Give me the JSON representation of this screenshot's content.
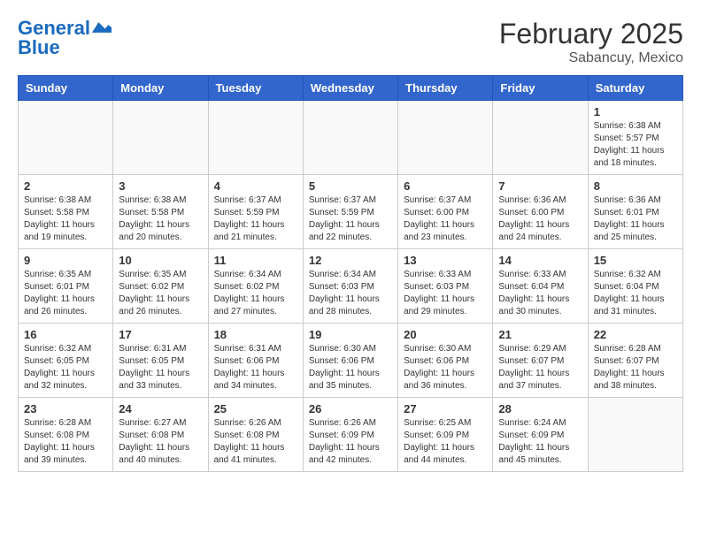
{
  "header": {
    "logo_line1": "General",
    "logo_line2": "Blue",
    "month_year": "February 2025",
    "location": "Sabancuy, Mexico"
  },
  "weekdays": [
    "Sunday",
    "Monday",
    "Tuesday",
    "Wednesday",
    "Thursday",
    "Friday",
    "Saturday"
  ],
  "weeks": [
    [
      {
        "day": "",
        "info": ""
      },
      {
        "day": "",
        "info": ""
      },
      {
        "day": "",
        "info": ""
      },
      {
        "day": "",
        "info": ""
      },
      {
        "day": "",
        "info": ""
      },
      {
        "day": "",
        "info": ""
      },
      {
        "day": "1",
        "info": "Sunrise: 6:38 AM\nSunset: 5:57 PM\nDaylight: 11 hours and 18 minutes."
      }
    ],
    [
      {
        "day": "2",
        "info": "Sunrise: 6:38 AM\nSunset: 5:58 PM\nDaylight: 11 hours and 19 minutes."
      },
      {
        "day": "3",
        "info": "Sunrise: 6:38 AM\nSunset: 5:58 PM\nDaylight: 11 hours and 20 minutes."
      },
      {
        "day": "4",
        "info": "Sunrise: 6:37 AM\nSunset: 5:59 PM\nDaylight: 11 hours and 21 minutes."
      },
      {
        "day": "5",
        "info": "Sunrise: 6:37 AM\nSunset: 5:59 PM\nDaylight: 11 hours and 22 minutes."
      },
      {
        "day": "6",
        "info": "Sunrise: 6:37 AM\nSunset: 6:00 PM\nDaylight: 11 hours and 23 minutes."
      },
      {
        "day": "7",
        "info": "Sunrise: 6:36 AM\nSunset: 6:00 PM\nDaylight: 11 hours and 24 minutes."
      },
      {
        "day": "8",
        "info": "Sunrise: 6:36 AM\nSunset: 6:01 PM\nDaylight: 11 hours and 25 minutes."
      }
    ],
    [
      {
        "day": "9",
        "info": "Sunrise: 6:35 AM\nSunset: 6:01 PM\nDaylight: 11 hours and 26 minutes."
      },
      {
        "day": "10",
        "info": "Sunrise: 6:35 AM\nSunset: 6:02 PM\nDaylight: 11 hours and 26 minutes."
      },
      {
        "day": "11",
        "info": "Sunrise: 6:34 AM\nSunset: 6:02 PM\nDaylight: 11 hours and 27 minutes."
      },
      {
        "day": "12",
        "info": "Sunrise: 6:34 AM\nSunset: 6:03 PM\nDaylight: 11 hours and 28 minutes."
      },
      {
        "day": "13",
        "info": "Sunrise: 6:33 AM\nSunset: 6:03 PM\nDaylight: 11 hours and 29 minutes."
      },
      {
        "day": "14",
        "info": "Sunrise: 6:33 AM\nSunset: 6:04 PM\nDaylight: 11 hours and 30 minutes."
      },
      {
        "day": "15",
        "info": "Sunrise: 6:32 AM\nSunset: 6:04 PM\nDaylight: 11 hours and 31 minutes."
      }
    ],
    [
      {
        "day": "16",
        "info": "Sunrise: 6:32 AM\nSunset: 6:05 PM\nDaylight: 11 hours and 32 minutes."
      },
      {
        "day": "17",
        "info": "Sunrise: 6:31 AM\nSunset: 6:05 PM\nDaylight: 11 hours and 33 minutes."
      },
      {
        "day": "18",
        "info": "Sunrise: 6:31 AM\nSunset: 6:06 PM\nDaylight: 11 hours and 34 minutes."
      },
      {
        "day": "19",
        "info": "Sunrise: 6:30 AM\nSunset: 6:06 PM\nDaylight: 11 hours and 35 minutes."
      },
      {
        "day": "20",
        "info": "Sunrise: 6:30 AM\nSunset: 6:06 PM\nDaylight: 11 hours and 36 minutes."
      },
      {
        "day": "21",
        "info": "Sunrise: 6:29 AM\nSunset: 6:07 PM\nDaylight: 11 hours and 37 minutes."
      },
      {
        "day": "22",
        "info": "Sunrise: 6:28 AM\nSunset: 6:07 PM\nDaylight: 11 hours and 38 minutes."
      }
    ],
    [
      {
        "day": "23",
        "info": "Sunrise: 6:28 AM\nSunset: 6:08 PM\nDaylight: 11 hours and 39 minutes."
      },
      {
        "day": "24",
        "info": "Sunrise: 6:27 AM\nSunset: 6:08 PM\nDaylight: 11 hours and 40 minutes."
      },
      {
        "day": "25",
        "info": "Sunrise: 6:26 AM\nSunset: 6:08 PM\nDaylight: 11 hours and 41 minutes."
      },
      {
        "day": "26",
        "info": "Sunrise: 6:26 AM\nSunset: 6:09 PM\nDaylight: 11 hours and 42 minutes."
      },
      {
        "day": "27",
        "info": "Sunrise: 6:25 AM\nSunset: 6:09 PM\nDaylight: 11 hours and 44 minutes."
      },
      {
        "day": "28",
        "info": "Sunrise: 6:24 AM\nSunset: 6:09 PM\nDaylight: 11 hours and 45 minutes."
      },
      {
        "day": "",
        "info": ""
      }
    ]
  ]
}
